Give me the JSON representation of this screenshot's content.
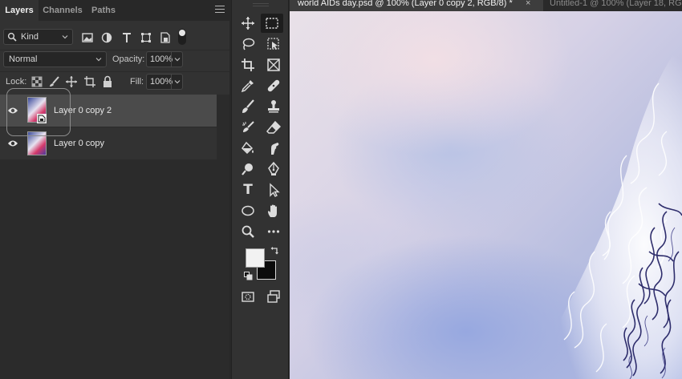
{
  "layers_panel": {
    "tabs": [
      {
        "label": "Layers",
        "active": true
      },
      {
        "label": "Channels",
        "active": false
      },
      {
        "label": "Paths",
        "active": false
      }
    ],
    "filter": {
      "label": "Kind"
    },
    "blend_mode": "Normal",
    "opacity": {
      "label": "Opacity:",
      "value": "100%"
    },
    "lock": {
      "label": "Lock:"
    },
    "fill": {
      "label": "Fill:",
      "value": "100%"
    },
    "layers": [
      {
        "name": "Layer 0 copy 2",
        "selected": true
      },
      {
        "name": "Layer 0 copy",
        "selected": false
      }
    ]
  },
  "toolbar": {
    "tools": [
      "rectangular-marquee",
      "move",
      "lasso",
      "object-selection",
      "crop",
      "frame",
      "eyedropper",
      "healing-brush",
      "brush",
      "clone-stamp",
      "history-brush",
      "eraser",
      "paint-bucket",
      "smudge",
      "dodge",
      "pen",
      "type",
      "path-selection",
      "ellipse",
      "hand",
      "zoom",
      "more"
    ],
    "type_tool_glyph": "T",
    "foreground_color": "#f2f2f2",
    "background_color": "#0c0c0c"
  },
  "documents": {
    "tabs": [
      {
        "label": "world AIDs day.psd @ 100% (Layer 0 copy 2, RGB/8) *",
        "active": true
      },
      {
        "label": "Untitled-1 @ 100% (Layer 18, RG",
        "active": false
      }
    ],
    "close_glyph": "×"
  }
}
